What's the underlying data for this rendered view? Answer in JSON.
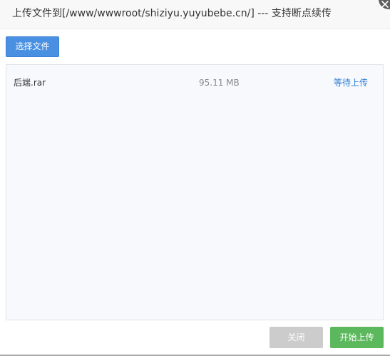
{
  "dialog": {
    "title": "上传文件到[/www/wwwroot/shiziyu.yuyubebe.cn/] --- 支持断点续传"
  },
  "toolbar": {
    "choose_label": "选择文件"
  },
  "files": [
    {
      "name": "后端.rar",
      "size": "95.11 MB",
      "status": "等待上传"
    }
  ],
  "footer": {
    "close_label": "关闭",
    "start_label": "开始上传"
  },
  "colors": {
    "primary": "#4a90e2",
    "success": "#5cb85c",
    "disabled": "#cccccc",
    "status_link": "#2a7bd4",
    "panel_bg": "#f8f9fd"
  }
}
